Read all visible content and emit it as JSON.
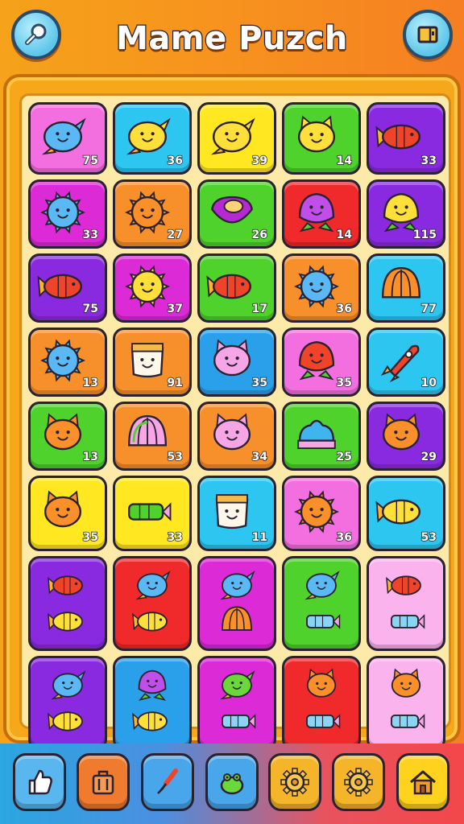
{
  "header": {
    "title": "Mame Puzch",
    "left_button_icon": "search-icon",
    "right_button_icon": "book-icon"
  },
  "colors": {
    "pink": "#f36fe0",
    "cyan": "#2cc6f0",
    "yellow": "#ffe822",
    "green": "#4fd22b",
    "purple": "#8a2ae0",
    "magenta": "#dc2ad6",
    "orange": "#f7902a",
    "red": "#f02a2a",
    "blue": "#2aa0ea",
    "lightpink": "#fbb3ee"
  },
  "board": {
    "rows": [
      [
        {
          "color": "pink",
          "icon": "blue-bird-icon",
          "count": "75"
        },
        {
          "color": "cyan",
          "icon": "yellow-bird-icon",
          "count": "36"
        },
        {
          "color": "yellow",
          "icon": "yellow-bird-icon",
          "count": "39"
        },
        {
          "color": "green",
          "icon": "yellow-cat-icon",
          "count": "14"
        },
        {
          "color": "purple",
          "icon": "red-fish-icon",
          "count": "33"
        }
      ],
      [
        {
          "color": "magenta",
          "icon": "blue-sun-icon",
          "count": "33"
        },
        {
          "color": "orange",
          "icon": "orange-sun-icon",
          "count": "27"
        },
        {
          "color": "green",
          "icon": "purple-bowl-icon",
          "count": "26"
        },
        {
          "color": "red",
          "icon": "purple-blob-icon",
          "count": "14"
        },
        {
          "color": "purple",
          "icon": "yellow-flower-icon",
          "count": "115"
        }
      ],
      [
        {
          "color": "purple",
          "icon": "red-fish-icon",
          "count": "75"
        },
        {
          "color": "magenta",
          "icon": "yellow-sun-icon",
          "count": "37"
        },
        {
          "color": "green",
          "icon": "red-fish-icon",
          "count": "17"
        },
        {
          "color": "orange",
          "icon": "blue-sun-icon",
          "count": "36"
        },
        {
          "color": "cyan",
          "icon": "orange-shell-icon",
          "count": "77"
        }
      ],
      [
        {
          "color": "orange",
          "icon": "blue-sun-icon",
          "count": "13"
        },
        {
          "color": "orange",
          "icon": "white-box-icon",
          "count": "91"
        },
        {
          "color": "blue",
          "icon": "pink-cat-icon",
          "count": "35"
        },
        {
          "color": "pink",
          "icon": "red-blob-icon",
          "count": "35"
        },
        {
          "color": "cyan",
          "icon": "red-rocket-icon",
          "count": "10"
        }
      ],
      [
        {
          "color": "green",
          "icon": "orange-cat-icon",
          "count": "13"
        },
        {
          "color": "orange",
          "icon": "rainbow-shell-icon",
          "count": "53"
        },
        {
          "color": "orange",
          "icon": "pink-cat-icon",
          "count": "34"
        },
        {
          "color": "green",
          "icon": "blue-jelly-icon",
          "count": "25"
        },
        {
          "color": "purple",
          "icon": "orange-cat-icon",
          "count": "29"
        }
      ],
      [
        {
          "color": "yellow",
          "icon": "orange-cat-icon",
          "count": "35"
        },
        {
          "color": "yellow",
          "icon": "green-candy-icon",
          "count": "33"
        },
        {
          "color": "cyan",
          "icon": "white-box-icon",
          "count": "11"
        },
        {
          "color": "pink",
          "icon": "orange-sun-icon",
          "count": "36"
        },
        {
          "color": "cyan",
          "icon": "yellow-fish-icon",
          "count": "53"
        }
      ],
      [
        {
          "color": "purple",
          "icon": "feather-fish-icon",
          "count": ""
        },
        {
          "color": "red",
          "icon": "bird-fish-icon",
          "count": ""
        },
        {
          "color": "magenta",
          "icon": "bird-shell-icon",
          "count": ""
        },
        {
          "color": "green",
          "icon": "bird-candy-icon",
          "count": ""
        },
        {
          "color": "lightpink",
          "icon": "feather-candy-icon",
          "count": ""
        }
      ],
      [
        {
          "color": "purple",
          "icon": "bird-fish-icon",
          "count": ""
        },
        {
          "color": "blue",
          "icon": "leaf-fish-icon",
          "count": ""
        },
        {
          "color": "magenta",
          "icon": "frog-candy-icon",
          "count": ""
        },
        {
          "color": "red",
          "icon": "cat-candy-icon",
          "count": ""
        },
        {
          "color": "lightpink",
          "icon": "cat-candy-icon",
          "count": ""
        }
      ]
    ]
  },
  "toolbar": [
    {
      "icon": "thumbs-up-icon",
      "color": "#5ab6ee"
    },
    {
      "icon": "briefcase-icon",
      "color": "#f07a2e"
    },
    {
      "icon": "brush-icon",
      "color": "#4aa6ea"
    },
    {
      "icon": "frog-icon",
      "color": "#4aa6ea"
    },
    {
      "icon": "gear-icon",
      "color": "#f4b52a"
    },
    {
      "icon": "gear-icon",
      "color": "#f4b52a"
    },
    {
      "icon": "house-icon",
      "color": "#ffd21e"
    }
  ]
}
